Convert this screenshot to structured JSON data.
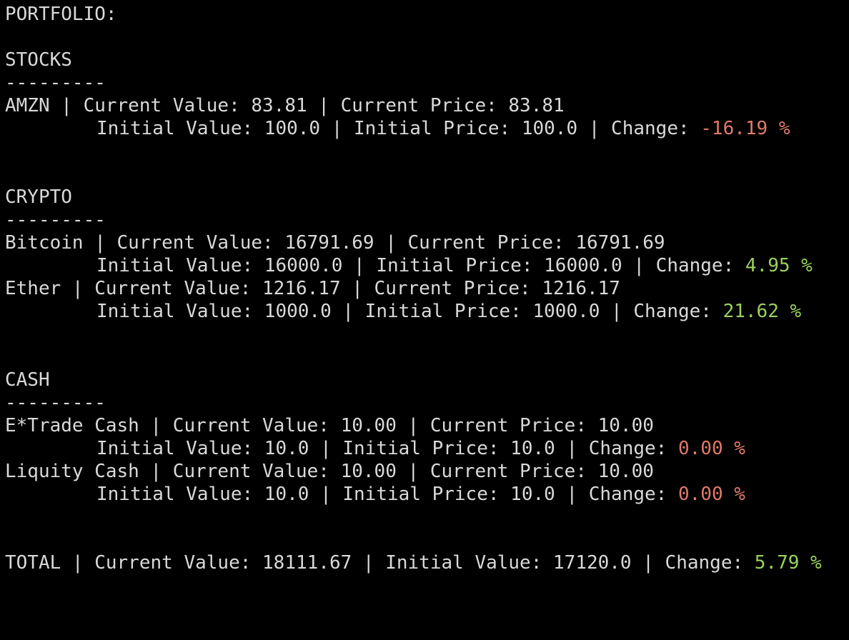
{
  "header": "PORTFOLIO:",
  "separator": "---------",
  "stocks": {
    "title": "STOCKS",
    "rows": [
      {
        "line1": "AMZN | Current Value: 83.81 | Current Price: 83.81",
        "line2_prefix": "Initial Value: 100.0 | Initial Price: 100.0 | Change: ",
        "change": "-16.19 %"
      }
    ]
  },
  "crypto": {
    "title": "CRYPTO",
    "rows": [
      {
        "line1": "Bitcoin | Current Value: 16791.69 | Current Price: 16791.69",
        "line2_prefix": "Initial Value: 16000.0 | Initial Price: 16000.0 | Change: ",
        "change": "4.95 %"
      },
      {
        "line1": "Ether | Current Value: 1216.17 | Current Price: 1216.17",
        "line2_prefix": "Initial Value: 1000.0 | Initial Price: 1000.0 | Change: ",
        "change": "21.62 %"
      }
    ]
  },
  "cash": {
    "title": "CASH",
    "rows": [
      {
        "line1": "E*Trade Cash | Current Value: 10.00 | Current Price: 10.00",
        "line2_prefix": "Initial Value: 10.0 | Initial Price: 10.0 | Change: ",
        "change": "0.00 %"
      },
      {
        "line1": "Liquity Cash | Current Value: 10.00 | Current Price: 10.00",
        "line2_prefix": "Initial Value: 10.0 | Initial Price: 10.0 | Change: ",
        "change": "0.00 %"
      }
    ]
  },
  "total": {
    "prefix": "TOTAL | Current Value: 18111.67 | Initial Value: 17120.0 | Change: ",
    "change": "5.79 %"
  },
  "colors": {
    "background": "#000000",
    "text": "#d9d9d9",
    "negative": "#e07a6b",
    "positive": "#9bd15e"
  }
}
